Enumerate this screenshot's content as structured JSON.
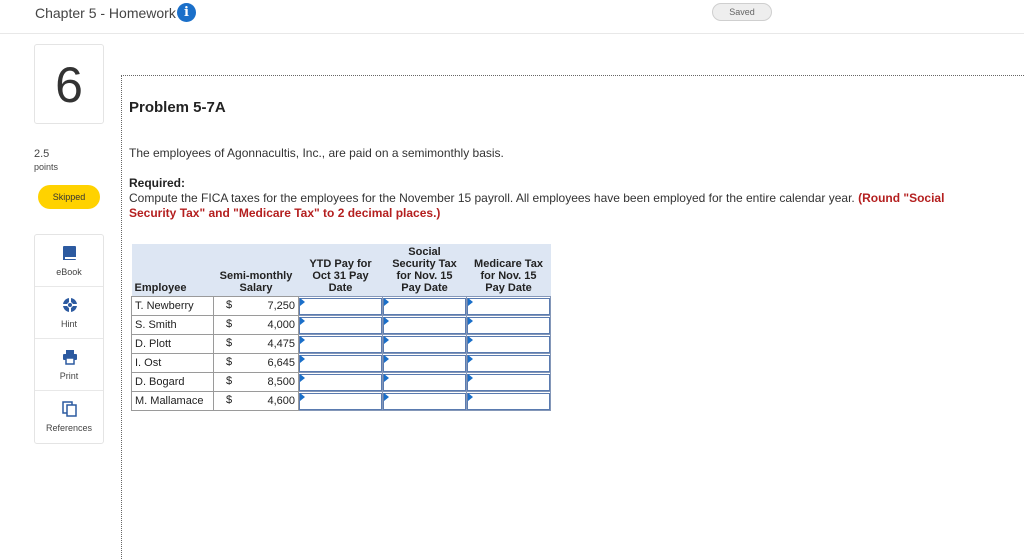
{
  "header": {
    "title": "Chapter 5 - Homework",
    "saved_label": "Saved"
  },
  "question": {
    "number": "6",
    "points_value": "2.5",
    "points_label": "points",
    "status": "Skipped"
  },
  "tools": [
    {
      "label": "eBook",
      "icon": "book-icon"
    },
    {
      "label": "Hint",
      "icon": "lifebuoy-icon"
    },
    {
      "label": "Print",
      "icon": "printer-icon"
    },
    {
      "label": "References",
      "icon": "references-icon"
    }
  ],
  "problem": {
    "title": "Problem 5-7A",
    "intro": "The employees of Agonnacultis, Inc., are paid on a semimonthly basis.",
    "required_heading": "Required:",
    "required_text": "Compute the FICA taxes for the employees for the November 15 payroll. All employees have been employed for the entire calendar year.",
    "required_note": "(Round \"Social Security Tax\" and \"Medicare Tax\" to 2 decimal places.)"
  },
  "table": {
    "columns": {
      "employee": "Employee",
      "salary": "Semi-monthly Salary",
      "ytd": "YTD Pay for Oct 31 Pay Date",
      "ss": "Social Security Tax for Nov. 15 Pay Date",
      "medicare": "Medicare Tax for Nov. 15 Pay Date"
    },
    "currency": "$",
    "rows": [
      {
        "name": "T. Newberry",
        "salary": "7,250"
      },
      {
        "name": "S. Smith",
        "salary": "4,000"
      },
      {
        "name": "D. Plott",
        "salary": "4,475"
      },
      {
        "name": "I. Ost",
        "salary": "6,645"
      },
      {
        "name": "D. Bogard",
        "salary": "8,500"
      },
      {
        "name": "M. Mallamace",
        "salary": "4,600"
      }
    ]
  },
  "colors": {
    "accent_blue": "#1a6fc9",
    "skipped_yellow": "#ffd200",
    "note_red": "#b41f1f",
    "header_fill": "#dde6f3"
  }
}
